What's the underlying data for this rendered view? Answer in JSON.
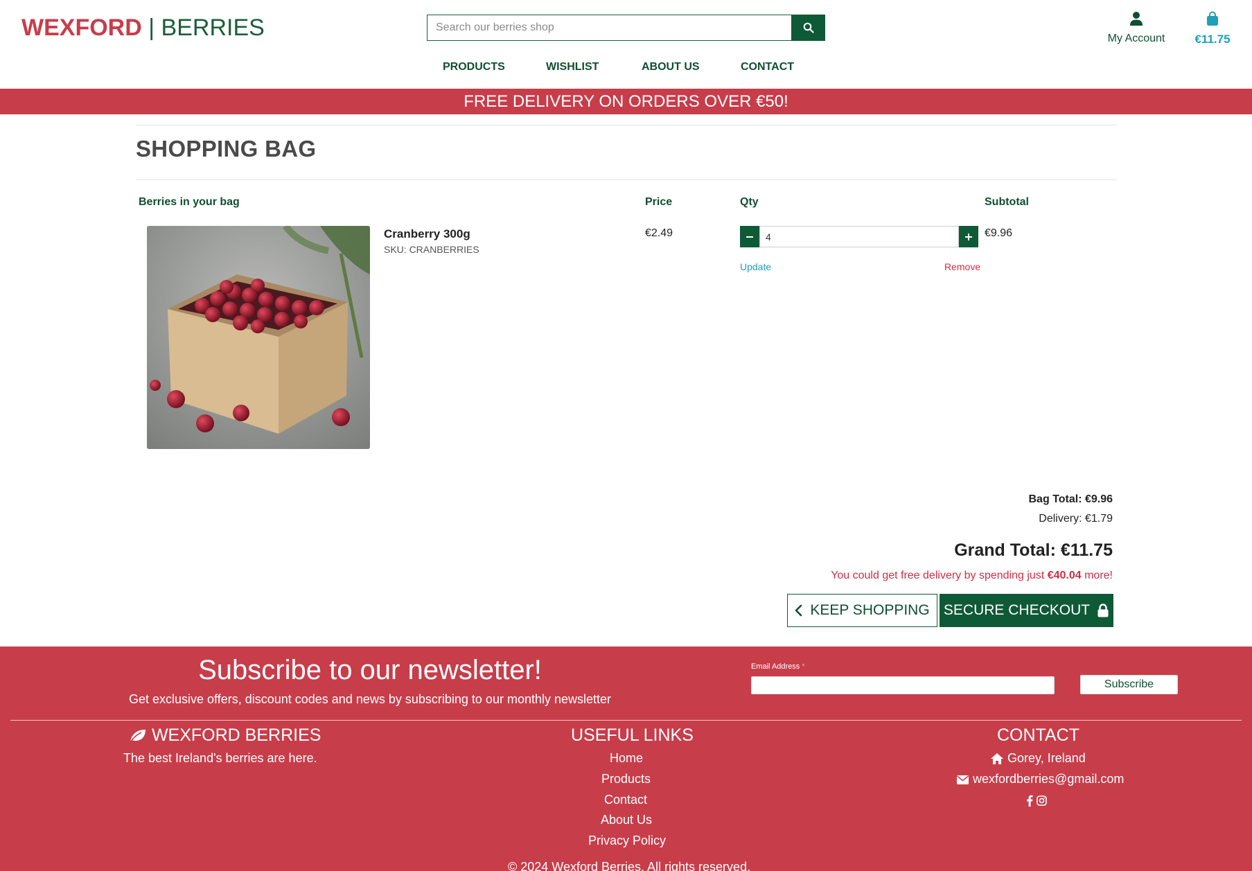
{
  "header": {
    "logo_primary": "WEXFORD",
    "logo_separator": "|",
    "logo_secondary": "BERRIES",
    "search_placeholder": "Search our berries shop",
    "account_label": "My Account",
    "bag_total": "€11.75"
  },
  "nav": {
    "items": [
      {
        "label": "PRODUCTS"
      },
      {
        "label": "WISHLIST"
      },
      {
        "label": "ABOUT US"
      },
      {
        "label": "CONTACT"
      }
    ]
  },
  "banner": {
    "text": "FREE DELIVERY ON ORDERS OVER €50!"
  },
  "page": {
    "title": "SHOPPING BAG"
  },
  "table": {
    "headers": {
      "item": "Berries in your bag",
      "price": "Price",
      "qty": "Qty",
      "subtotal": "Subtotal"
    },
    "rows": [
      {
        "name": "Cranberry 300g",
        "sku": "SKU: CRANBERRIES",
        "price": "€2.49",
        "qty": "4",
        "subtotal": "€9.96",
        "update_label": "Update",
        "remove_label": "Remove"
      }
    ]
  },
  "summary": {
    "bag_total": "Bag Total: €9.96",
    "delivery": "Delivery: €1.79",
    "grand_total": "Grand Total: €11.75",
    "free_delivery_prefix": "You could get free delivery by spending just",
    "free_delivery_amount": "€40.04",
    "free_delivery_suffix": "more!"
  },
  "buttons": {
    "keep_shopping": "KEEP SHOPPING",
    "secure_checkout": "SECURE CHECKOUT"
  },
  "footer": {
    "newsletter_title": "Subscribe to our newsletter!",
    "newsletter_subtitle": "Get exclusive offers, discount codes and news by subscribing to our monthly newsletter",
    "email_label": "Email Address",
    "email_required": "*",
    "subscribe_label": "Subscribe",
    "brand_title": "WEXFORD BERRIES",
    "brand_tagline": "The best Ireland's berries are here.",
    "links_title": "USEFUL LINKS",
    "links": [
      {
        "label": "Home"
      },
      {
        "label": "Products"
      },
      {
        "label": "Contact"
      },
      {
        "label": "About Us"
      },
      {
        "label": "Privacy Policy"
      }
    ],
    "contact_title": "CONTACT",
    "contact_location": "Gorey, Ireland",
    "contact_email": "wexfordberries@gmail.com",
    "copyright": "© 2024 Wexford Berries. All rights reserved."
  },
  "colors": {
    "brand_red": "#c83d4a",
    "brand_green": "#0f5a36",
    "link_teal": "#1ea0b8",
    "alert_red": "#d42c43"
  },
  "icons": [
    "search-icon",
    "user-icon",
    "shopping-bag-icon",
    "minus-icon",
    "plus-icon",
    "chevron-left-icon",
    "lock-icon",
    "leaf-icon",
    "home-icon",
    "envelope-icon",
    "facebook-icon",
    "instagram-icon"
  ]
}
